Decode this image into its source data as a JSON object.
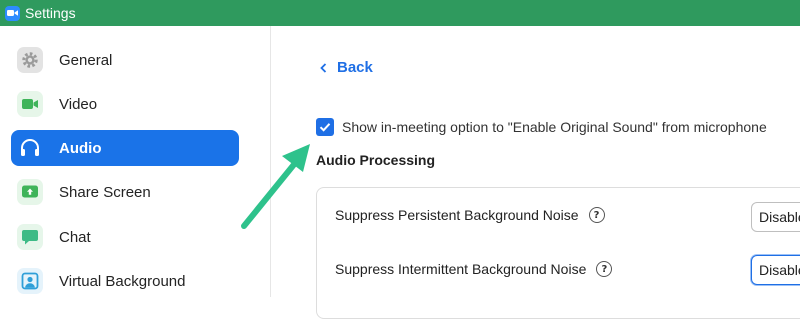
{
  "window": {
    "title": "Settings"
  },
  "colors": {
    "titlebar": "#2f9a5e",
    "accent": "#1f6fe5",
    "active_nav": "#1a73e8",
    "arrow": "#2ec28c"
  },
  "sidebar": {
    "items": [
      {
        "label": "General",
        "icon": "gear-icon",
        "active": false
      },
      {
        "label": "Video",
        "icon": "video-camera-icon",
        "active": false
      },
      {
        "label": "Audio",
        "icon": "headphones-icon",
        "active": true
      },
      {
        "label": "Share Screen",
        "icon": "share-screen-icon",
        "active": false
      },
      {
        "label": "Chat",
        "icon": "chat-bubble-icon",
        "active": false
      },
      {
        "label": "Virtual Background",
        "icon": "person-background-icon",
        "active": false
      }
    ]
  },
  "main": {
    "back_label": "Back",
    "original_sound_option": {
      "label": "Show in-meeting option to \"Enable Original Sound\" from microphone",
      "checked": true
    },
    "audio_processing": {
      "title": "Audio Processing",
      "rows": [
        {
          "label": "Suppress Persistent Background Noise",
          "value": "Disable"
        },
        {
          "label": "Suppress Intermittent Background Noise",
          "value": "Disable"
        }
      ]
    }
  }
}
